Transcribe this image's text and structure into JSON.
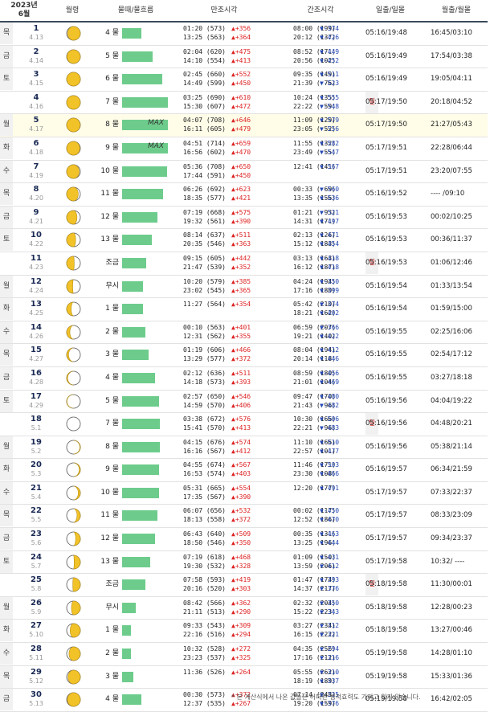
{
  "header": {
    "year": "2023년",
    "month": "6월",
    "moon": "월령",
    "tide": "물때/물흐름",
    "high": "만조시각",
    "low": "간조시각",
    "sun": "일출/일몰",
    "moonrise": "월출/월몰"
  },
  "rows": [
    {
      "dow": "목",
      "day": "1",
      "lunar": "4.13",
      "phase": 0.93,
      "tide": "4 물",
      "bar": 0.42,
      "max": "",
      "high1": "01:20 (573)",
      "high1d": "▲+356",
      "high2": "13:25 (563)",
      "high2d": "▲+364",
      "low1": "08:00 (199)",
      "low1d": "▼-374",
      "low2": "20:12 (137)",
      "low2d": "▼-426",
      "sun": "05:16/19:48",
      "mr": "16:45/03:10"
    },
    {
      "dow": "금",
      "day": "2",
      "lunar": "4.14",
      "phase": 0.98,
      "tide": "5 물",
      "bar": 0.67,
      "max": "",
      "high1": "02:04 (620)",
      "high1d": "▲+475",
      "high2": "14:10 (554)",
      "high2d": "▲+413",
      "low1": "08:52 (171)",
      "low1d": "▼-449",
      "low2": "20:56 (102)",
      "low2d": "▼-452",
      "sun": "05:16/19:49",
      "mr": "17:54/03:38"
    },
    {
      "dow": "토",
      "day": "3",
      "lunar": "4.15",
      "phase": 1.0,
      "tide": "6 물",
      "bar": 0.87,
      "max": "",
      "high1": "02:45 (660)",
      "high1d": "▲+552",
      "high2": "14:49 (599)",
      "high2d": "▲+450",
      "low1": "09:35 (149)",
      "low1d": "▼-511",
      "low2": "21:39 ( 76)",
      "low2d": "▼-523",
      "sun": "05:16/19:49",
      "mr": "19:05/04:11"
    },
    {
      "dow": "일",
      "day": "4",
      "lunar": "4.16",
      "phase": 1.0,
      "tide": "7 물",
      "bar": 1.0,
      "max": "",
      "high1": "03:25 (690)",
      "high1d": "▲+610",
      "high2": "15:30 (607)",
      "high2d": "▲+472",
      "low1": "10:24 (135)",
      "low1d": "▼-555",
      "low2": "22:22 ( 59)",
      "low2d": "▼-548",
      "sun": "05:17/19:50",
      "mr": "20:18/04:52"
    },
    {
      "dow": "월",
      "day": "5",
      "lunar": "4.17",
      "phase": 0.99,
      "tide": "8 물",
      "bar": 1.0,
      "max": "MAX",
      "high1": "04:07 (708)",
      "high1d": "▲+646",
      "high2": "16:11 (605)",
      "high2d": "▲+479",
      "low1": "11:09 (129)",
      "low1d": "▼-579",
      "low2": "23:05 ( 52)",
      "low2d": "▼-556",
      "sun": "05:17/19:50",
      "mr": "21:27/05:43"
    },
    {
      "dow": "화",
      "day": "6",
      "lunar": "4.18",
      "phase": 0.97,
      "tide": "9 물",
      "bar": 1.0,
      "max": "MAX",
      "high1": "04:51 (714)",
      "high1d": "▲+659",
      "high2": "16:56 (602)",
      "high2d": "▲+470",
      "low1": "11:55 (132)",
      "low1d": "▼-582",
      "low2": "23:49 ( 55)",
      "low2d": "▼-547",
      "sun": "05:17/19:51",
      "mr": "22:28/06:44"
    },
    {
      "dow": "수",
      "day": "7",
      "lunar": "4.19",
      "phase": 0.92,
      "tide": "10 물",
      "bar": 0.98,
      "max": "",
      "high1": "05:36 (708)",
      "high1d": "▲+650",
      "high2": "17:44 (591)",
      "high2d": "▲+450",
      "low1": "12:41 (141)",
      "low1d": "▼-567",
      "low2": "",
      "low2d": "",
      "sun": "05:17/19:51",
      "mr": "23:20/07:55"
    },
    {
      "dow": "목",
      "day": "8",
      "lunar": "4.20",
      "phase": 0.85,
      "tide": "11 물",
      "bar": 0.9,
      "max": "",
      "high1": "06:26 (692)",
      "high1d": "▲+623",
      "high2": "18:35 (577)",
      "high2d": "▲+421",
      "low1": "00:33 ( 69)",
      "low1d": "▼-560",
      "low2": "13:35 (156)",
      "low2d": "▼-536",
      "sun": "05:16/19:52",
      "mr": "---- /09:10"
    },
    {
      "dow": "금",
      "day": "9",
      "lunar": "4.21",
      "phase": 0.76,
      "tide": "12 물",
      "bar": 0.78,
      "max": "",
      "high1": "07:19 (668)",
      "high1d": "▲+575",
      "high2": "19:32 (561)",
      "high2d": "▲+390",
      "low1": "01:21 ( 93)",
      "low1d": "▼-521",
      "low2": "14:31 (171)",
      "low2d": "▼-497",
      "sun": "05:16/19:53",
      "mr": "00:02/10:25"
    },
    {
      "dow": "토",
      "day": "10",
      "lunar": "4.22",
      "phase": 0.66,
      "tide": "13 물",
      "bar": 0.65,
      "max": "",
      "high1": "08:14 (637)",
      "high1d": "▲+511",
      "high2": "20:35 (546)",
      "high2d": "▲+363",
      "low1": "02:13 (126)",
      "low1d": "▼-471",
      "low2": "15:12 (183)",
      "low2d": "▼-454",
      "sun": "05:16/19:53",
      "mr": "00:36/11:37"
    },
    {
      "dow": "일",
      "day": "11",
      "lunar": "4.23",
      "phase": 0.55,
      "tide": "조금",
      "bar": 0.52,
      "max": "",
      "high1": "09:15 (605)",
      "high1d": "▲+442",
      "high2": "21:47 (539)",
      "high2d": "▲+352",
      "low1": "03:13 (163)",
      "low1d": "▼-418",
      "low2": "16:12 (187)",
      "low2d": "▼-418",
      "sun": "05:16/19:53",
      "mr": "01:06/12:46"
    },
    {
      "dow": "월",
      "day": "12",
      "lunar": "4.24",
      "phase": 0.44,
      "tide": "무시",
      "bar": 0.45,
      "max": "",
      "high1": "10:20 (579)",
      "high1d": "▲+385",
      "high2": "23:02 (545)",
      "high2d": "▲+365",
      "low1": "04:24 (194)",
      "low1d": "▼-350",
      "low2": "17:16 (180)",
      "low2d": "▼-399",
      "sun": "05:16/19:54",
      "mr": "01:33/13:54"
    },
    {
      "dow": "화",
      "day": "13",
      "lunar": "4.25",
      "phase": 0.33,
      "tide": "1 물",
      "bar": 0.45,
      "max": "",
      "high1": "11:27 (564)",
      "high1d": "▲+354",
      "high2": "",
      "high2d": "",
      "low1": "05:42 (210)",
      "low1d": "▼-374",
      "low2": "18:21 (162)",
      "low2d": "▼-402",
      "sun": "05:16/19:54",
      "mr": "01:59/15:00"
    },
    {
      "dow": "수",
      "day": "14",
      "lunar": "4.26",
      "phase": 0.23,
      "tide": "2 물",
      "bar": 0.5,
      "max": "",
      "high1": "00:10 (563)",
      "high1d": "▲+401",
      "high2": "12:31 (562)",
      "high2d": "▲+355",
      "low1": "06:59 (207)",
      "low1d": "▼-366",
      "low2": "19:21 (140)",
      "low2d": "▼-422",
      "sun": "05:16/19:55",
      "mr": "02:25/16:06"
    },
    {
      "dow": "목",
      "day": "15",
      "lunar": "4.27",
      "phase": 0.14,
      "tide": "3 물",
      "bar": 0.58,
      "max": "",
      "high1": "01:19 (606)",
      "high1d": "▲+466",
      "high2": "13:29 (577)",
      "high2d": "▲+372",
      "low1": "08:04 (194)",
      "low1d": "▼-412",
      "low2": "20:14 (118)",
      "low2d": "▼-446",
      "sun": "05:16/19:55",
      "mr": "02:54/17:12"
    },
    {
      "dow": "금",
      "day": "16",
      "lunar": "4.28",
      "phase": 0.07,
      "tide": "4 물",
      "bar": 0.72,
      "max": "",
      "high1": "02:12 (636)",
      "high1d": "▲+511",
      "high2": "14:18 (573)",
      "high2d": "▲+393",
      "low1": "08:59 (180)",
      "low1d": "▼-456",
      "low2": "21:01 (104)",
      "low2d": "▼-469",
      "sun": "05:16/19:55",
      "mr": "03:27/18:18"
    },
    {
      "dow": "토",
      "day": "17",
      "lunar": "4.29",
      "phase": 0.02,
      "tide": "5 물",
      "bar": 0.8,
      "max": "",
      "high1": "02:57 (650)",
      "high1d": "▲+546",
      "high2": "14:59 (570)",
      "high2d": "▲+406",
      "low1": "09:47 (170)",
      "low1d": "▼-480",
      "low2": "21:43 ( 96)",
      "low2d": "▼-482",
      "sun": "05:16/19:56",
      "mr": "04:04/19:22"
    },
    {
      "dow": "일",
      "day": "18",
      "lunar": "5.1",
      "phase": 0.0,
      "tide": "7 물",
      "bar": 0.82,
      "max": "",
      "high1": "03:38 (672)",
      "high1d": "▲+576",
      "high2": "15:41 (570)",
      "high2d": "▲+413",
      "low1": "10:30 (166)",
      "low1d": "▼-506",
      "low2": "22:21 ( 96)",
      "low2d": "▼-483",
      "sun": "05:16/19:56",
      "mr": "04:48/20:21"
    },
    {
      "dow": "월",
      "day": "19",
      "lunar": "5.2",
      "phase": 0.03,
      "tide": "8 물",
      "bar": 0.82,
      "max": "",
      "high1": "04:15 (676)",
      "high1d": "▲+574",
      "high2": "16:16 (567)",
      "high2d": "▲+412",
      "low1": "11:10 (166)",
      "low1d": "▼-510",
      "low2": "22:57 (101)",
      "low2d": "▼-477",
      "sun": "05:16/19:56",
      "mr": "05:38/21:14"
    },
    {
      "dow": "화",
      "day": "20",
      "lunar": "5.3",
      "phase": 0.08,
      "tide": "9 물",
      "bar": 0.8,
      "max": "",
      "high1": "04:55 (674)",
      "high1d": "▲+567",
      "high2": "16:53 (574)",
      "high2d": "▲+403",
      "low1": "11:46 (171)",
      "low1d": "▼-503",
      "low2": "23:30 (108)",
      "low2d": "▼-466",
      "sun": "05:16/19:57",
      "mr": "06:34/21:59"
    },
    {
      "dow": "수",
      "day": "21",
      "lunar": "5.4",
      "phase": 0.15,
      "tide": "10 물",
      "bar": 0.8,
      "max": "",
      "high1": "05:31 (665)",
      "high1d": "▲+554",
      "high2": "17:35 (567)",
      "high2d": "▲+390",
      "low1": "12:20 (177)",
      "low1d": "▼-491",
      "low2": "",
      "low2d": "",
      "sun": "05:17/19:57",
      "mr": "07:33/22:37"
    },
    {
      "dow": "목",
      "day": "22",
      "lunar": "5.5",
      "phase": 0.24,
      "tide": "11 물",
      "bar": 0.78,
      "max": "",
      "high1": "06:07 (656)",
      "high1d": "▲+532",
      "high2": "18:13 (558)",
      "high2d": "▲+372",
      "low1": "00:02 (117)",
      "low1d": "▼-450",
      "low2": "12:52 (186)",
      "low2d": "▼-470",
      "sun": "05:17/19:57",
      "mr": "08:33/23:09"
    },
    {
      "dow": "금",
      "day": "23",
      "lunar": "5.6",
      "phase": 0.34,
      "tide": "12 물",
      "bar": 0.72,
      "max": "",
      "high1": "06:43 (640)",
      "high1d": "▲+509",
      "high2": "18:50 (546)",
      "high2d": "▲+350",
      "low1": "00:35 (131)",
      "low1d": "▼-463",
      "low2": "13:25 (196)",
      "low2d": "▼-444",
      "sun": "05:17/19:57",
      "mr": "09:34/23:37"
    },
    {
      "dow": "토",
      "day": "24",
      "lunar": "5.7",
      "phase": 0.45,
      "tide": "13 물",
      "bar": 0.62,
      "max": "",
      "high1": "07:19 (618)",
      "high1d": "▲+468",
      "high2": "19:30 (532)",
      "high2d": "▲+328",
      "low1": "01:09 (150)",
      "low1d": "▼-431",
      "low2": "13:59 (206)",
      "low2d": "▼-412",
      "sun": "05:17/19:58",
      "mr": "10:32/ ----"
    },
    {
      "dow": "일",
      "day": "25",
      "lunar": "5.8",
      "phase": 0.55,
      "tide": "조금",
      "bar": 0.5,
      "max": "",
      "high1": "07:58 (593)",
      "high1d": "▲+419",
      "high2": "20:16 (520)",
      "high2d": "▲+303",
      "low1": "01:47 (174)",
      "low1d": "▼-393",
      "low2": "14:37 (217)",
      "low2d": "▼-376",
      "sun": "05:18/19:58",
      "mr": "11:30/00:01"
    },
    {
      "dow": "월",
      "day": "26",
      "lunar": "5.9",
      "phase": 0.65,
      "tide": "무시",
      "bar": 0.3,
      "max": "",
      "high1": "08:42 (566)",
      "high1d": "▲+362",
      "high2": "21:11 (513)",
      "high2d": "▲+290",
      "low1": "02:32 (204)",
      "low1d": "▼-350",
      "low2": "15:22 (223)",
      "low2d": "▼-343",
      "sun": "05:18/19:58",
      "mr": "12:28/00:23"
    },
    {
      "dow": "화",
      "day": "27",
      "lunar": "5.10",
      "phase": 0.75,
      "tide": "1 물",
      "bar": 0.2,
      "max": "",
      "high1": "09:33 (543)",
      "high1d": "▲+309",
      "high2": "22:16 (516)",
      "high2d": "▲+294",
      "low1": "03:27 (234)",
      "low1d": "▼-312",
      "low2": "16:15 (222)",
      "low2d": "▼-321",
      "sun": "05:18/19:58",
      "mr": "13:27/00:46"
    },
    {
      "dow": "수",
      "day": "28",
      "lunar": "5.11",
      "phase": 0.83,
      "tide": "2 물",
      "bar": 0.2,
      "max": "",
      "high1": "10:32 (528)",
      "high1d": "▲+272",
      "high2": "23:23 (537)",
      "high2d": "▲+325",
      "low1": "04:35 (256)",
      "low1d": "▼-294",
      "low2": "17:16 (212)",
      "low2d": "▼-316",
      "sun": "05:19/19:58",
      "mr": "14:28/01:10"
    },
    {
      "dow": "목",
      "day": "29",
      "lunar": "5.12",
      "phase": 0.9,
      "tide": "3 물",
      "bar": 0.25,
      "max": "",
      "high1": "11:36 (526)",
      "high1d": "▲+264",
      "high2": "",
      "high2d": "",
      "low1": "05:55 (262)",
      "low1d": "▼-310",
      "low2": "18:19 (189)",
      "low2d": "▼-337",
      "sun": "05:19/19:58",
      "mr": "15:33/01:36"
    },
    {
      "dow": "금",
      "day": "30",
      "lunar": "5.13",
      "phase": 0.95,
      "tide": "4 물",
      "bar": 0.42,
      "max": "",
      "high1": "00:30 (573)",
      "high1d": "▲+372",
      "high2": "12:37 (535)",
      "high2d": "▲+267",
      "low1": "07:14 (248)",
      "low1d": "▼-325",
      "low2": "19:20 (159)",
      "low2d": "▼-376",
      "sun": "05:19/19:58",
      "mr": "16:42/02:05"
    }
  ],
  "footnote": "* 본 계산식에서 나온 값들은 어떠한 법적효력도 가지고 있지 않습니다."
}
